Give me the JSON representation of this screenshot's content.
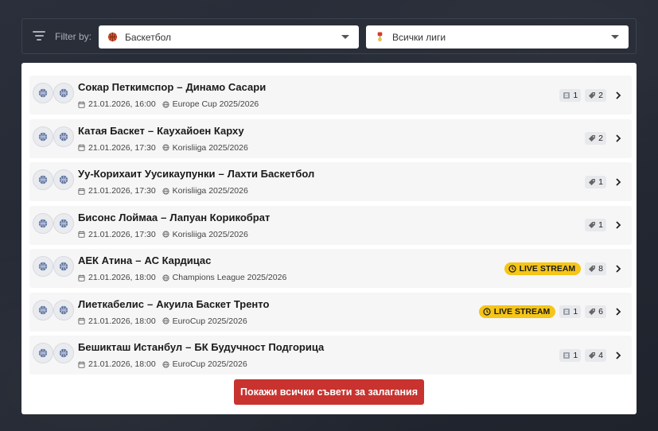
{
  "filter": {
    "label": "Filter by:",
    "sport": "Баскетбол",
    "league": "Всички лиги"
  },
  "colors": {
    "accent_button": "#c8332f",
    "live_badge": "#f5c518",
    "panel_bg": "#ffffff",
    "row_bg": "#f6f6f7"
  },
  "matches": [
    {
      "home": "Сокар Петкимспор",
      "away": "Динамо Сасари",
      "datetime": "21.01.2026, 16:00",
      "competition": "Europe Cup 2025/2026",
      "live": false,
      "stats": "1",
      "tips": "2"
    },
    {
      "home": "Катая Баскет",
      "away": "Каухайоен Карху",
      "datetime": "21.01.2026, 17:30",
      "competition": "Korisliiga 2025/2026",
      "live": false,
      "stats": null,
      "tips": "2"
    },
    {
      "home": "Уу-Корихаит Уусикаупунки",
      "away": "Лахти Баскетбол",
      "datetime": "21.01.2026, 17:30",
      "competition": "Korisliiga 2025/2026",
      "live": false,
      "stats": null,
      "tips": "1"
    },
    {
      "home": "Бисонс Лоймаа",
      "away": "Лапуан Корикобрат",
      "datetime": "21.01.2026, 17:30",
      "competition": "Korisliiga 2025/2026",
      "live": false,
      "stats": null,
      "tips": "1"
    },
    {
      "home": "АЕК Атина",
      "away": "АС Кардицас",
      "datetime": "21.01.2026, 18:00",
      "competition": "Champions League 2025/2026",
      "live": true,
      "stats": null,
      "tips": "8"
    },
    {
      "home": "Лиеткабелис",
      "away": "Акуила Баскет Тренто",
      "datetime": "21.01.2026, 18:00",
      "competition": "EuroCup 2025/2026",
      "live": true,
      "stats": "1",
      "tips": "6"
    },
    {
      "home": "Бешикташ Истанбул",
      "away": "БК Будучност Подгорица",
      "datetime": "21.01.2026, 18:00",
      "competition": "EuroCup 2025/2026",
      "live": false,
      "stats": "1",
      "tips": "4"
    }
  ],
  "live_label": "LIVE STREAM",
  "dash": "–",
  "cta_label": "Покажи всички съвети за залагания",
  "icons": {
    "filter": "filter-lines-icon",
    "sport": "basketball-icon",
    "league": "trophy-icon",
    "calendar": "calendar-icon",
    "competition": "globe-icon",
    "stats": "stats-list-icon",
    "tips": "tag-icon",
    "live": "clock-icon",
    "chevron": "chevron-right-icon"
  }
}
